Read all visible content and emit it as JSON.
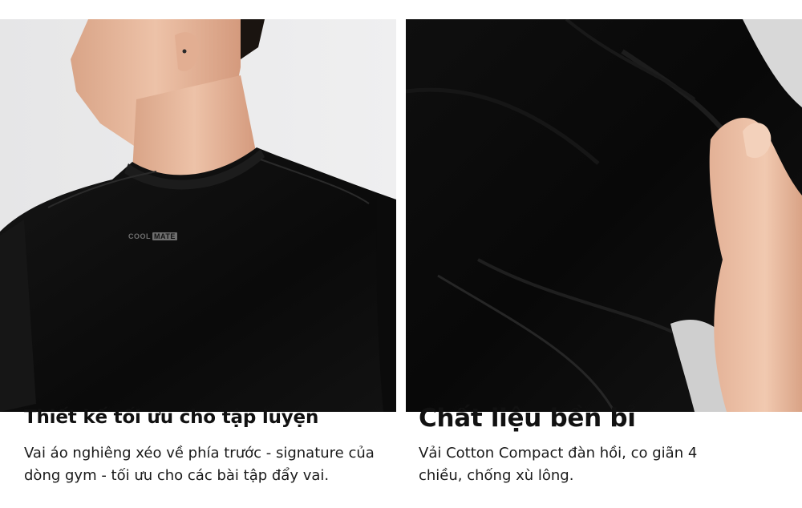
{
  "panels": [
    {
      "brand_text": "COOL",
      "brand_box": "MATE",
      "title": "Thiết kế tối ưu cho tập luyện",
      "description": "Vai áo nghiêng xéo về phía trước - signature của dòng gym - tối ưu cho các bài tập đẩy vai."
    },
    {
      "title": "Chất liệu bền bỉ",
      "description": "Vải Cotton Compact đàn hồi, co giãn 4 chiều, chống xù lông."
    }
  ],
  "colors": {
    "background": "#ffffff",
    "text": "#111111",
    "shirt": "#0d0d0d",
    "photo_bg_left": "#e9e9ea",
    "skin": "#e7b9a0"
  }
}
